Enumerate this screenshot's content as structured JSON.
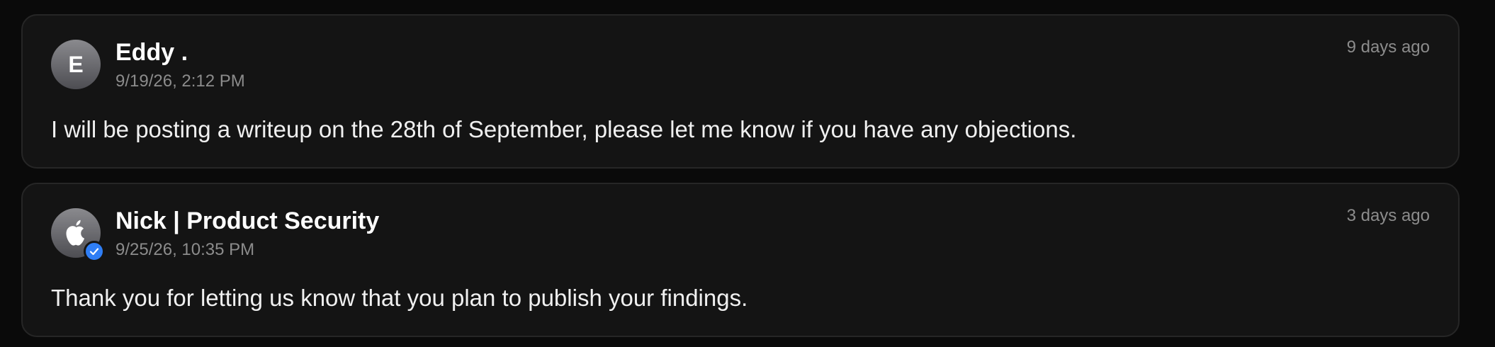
{
  "comments": [
    {
      "avatar_initial": "E",
      "author": "Eddy .",
      "date": "9/19/26, 2:12 PM",
      "relative_time": "9 days ago",
      "message": "I will be posting a writeup on the 28th of September, please let me know if you have any objections."
    },
    {
      "avatar_icon": "apple-logo-icon",
      "verified_icon": "verified-check-icon",
      "author": "Nick | Product Security",
      "date": "9/25/26, 10:35 PM",
      "relative_time": "3 days ago",
      "message": "Thank you for letting us know that you plan to publish your findings."
    }
  ],
  "colors": {
    "background": "#0a0a0a",
    "card": "#141414",
    "card_border": "#262626",
    "verified_badge": "#2f7ef5",
    "muted_text": "#8c8c8c"
  }
}
